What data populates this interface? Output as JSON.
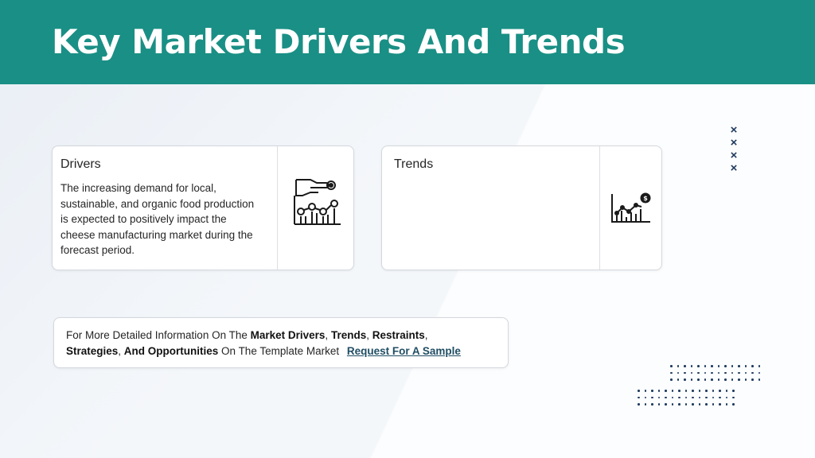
{
  "header": {
    "title": "Key Market Drivers And Trends"
  },
  "drivers": {
    "title": "Drivers",
    "body": "The increasing demand for local, sustainable, and organic food production is expected to positively impact the cheese manufacturing market during the forecast period.",
    "icon": "hand-graph-icon"
  },
  "trends": {
    "title": "Trends",
    "body": "",
    "icon": "bar-chart-dollar-icon"
  },
  "info": {
    "prefix": "For More Detailed Information On The ",
    "market_drivers": "Market Drivers",
    "sep1": ", ",
    "trends": "Trends",
    "sep2": ", ",
    "restraints": "Restraints",
    "sep3": ", ",
    "strategies": "Strategies",
    "sep4": ", ",
    "and_opportunities": "And Opportunities",
    "suffix": " On The Template Market ",
    "link": "Request For A Sample"
  },
  "decor": {
    "x_marks": [
      "×",
      "×",
      "×",
      "×"
    ]
  },
  "colors": {
    "header_bg": "#1a8f85",
    "accent_dark": "#1f3a5f",
    "link": "#1f4d63"
  }
}
